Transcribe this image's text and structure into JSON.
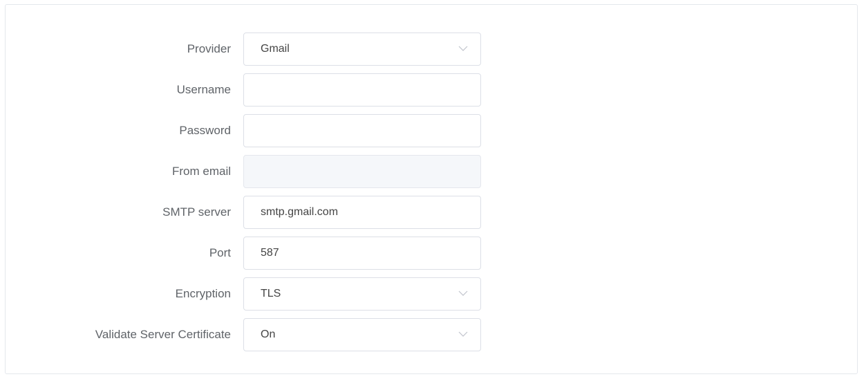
{
  "form": {
    "provider": {
      "label": "Provider",
      "value": "Gmail"
    },
    "username": {
      "label": "Username",
      "value": ""
    },
    "password": {
      "label": "Password",
      "value": ""
    },
    "from_email": {
      "label": "From email",
      "value": ""
    },
    "smtp_server": {
      "label": "SMTP server",
      "value": "smtp.gmail.com"
    },
    "port": {
      "label": "Port",
      "value": "587"
    },
    "encryption": {
      "label": "Encryption",
      "value": "TLS"
    },
    "validate_cert": {
      "label": "Validate Server Certificate",
      "value": "On"
    }
  }
}
